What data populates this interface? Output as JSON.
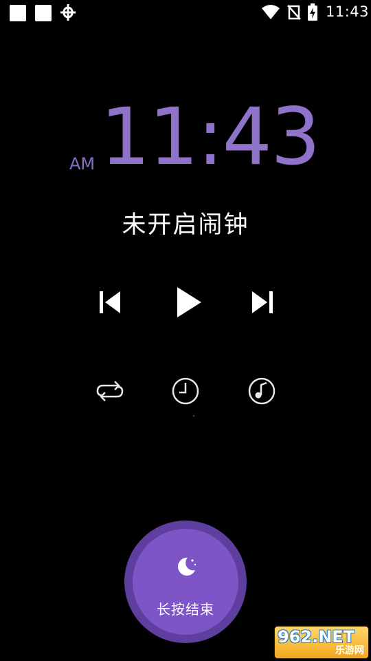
{
  "status_bar": {
    "time": "11:43",
    "icons": [
      "notification-square-icon",
      "notification-square-icon",
      "bug-icon",
      "wifi-icon",
      "no-signal-icon",
      "battery-charging-icon"
    ]
  },
  "clock": {
    "ampm": "AM",
    "time": "11:43",
    "color": "#8f72c9"
  },
  "alarm_status": "未开启闹钟",
  "media_controls": {
    "icons": [
      "skip-previous-icon",
      "play-icon",
      "skip-next-icon"
    ]
  },
  "secondary_controls": {
    "icons": [
      "repeat-icon",
      "timer-icon",
      "music-timer-icon"
    ]
  },
  "end_button": {
    "label": "长按结束",
    "icon": "moon-icon",
    "color": "#7d55c6"
  },
  "watermark": {
    "top": "962.NET",
    "bottom": "乐游网"
  }
}
